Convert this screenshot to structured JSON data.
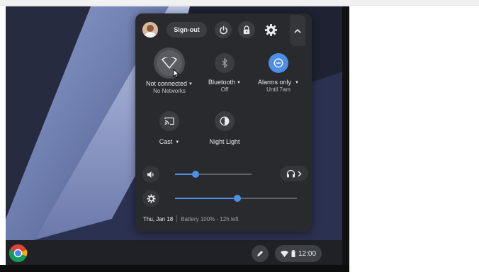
{
  "panel": {
    "sign_out_label": "Sign-out",
    "tiles": {
      "wifi": {
        "label": "Not connected",
        "sublabel": "No Networks"
      },
      "bluetooth": {
        "label": "Bluetooth",
        "sublabel": "Off"
      },
      "alarms": {
        "label": "Alarms only",
        "sublabel": "Until 7am"
      },
      "cast": {
        "label": "Cast"
      },
      "night_light": {
        "label": "Night Light"
      }
    },
    "volume_level": 0.27,
    "brightness_level": 0.51,
    "footer": {
      "date": "Thu, Jan 18",
      "battery": "Battery 100% - 12h left"
    }
  },
  "shelf": {
    "time": "12:00"
  },
  "icons": [
    "avatar",
    "power-icon",
    "lock-icon",
    "gear-icon",
    "chevron-up-icon",
    "wifi-icon",
    "bluetooth-icon",
    "do-not-disturb-icon",
    "cast-icon",
    "night-light-icon",
    "volume-icon",
    "headphones-icon",
    "brightness-icon",
    "chrome-icon",
    "pen-icon",
    "battery-icon"
  ],
  "colors": {
    "accent": "#4d8fe6",
    "panel_bg": "#292a2d",
    "dnd_active": "#4d8fe6"
  }
}
